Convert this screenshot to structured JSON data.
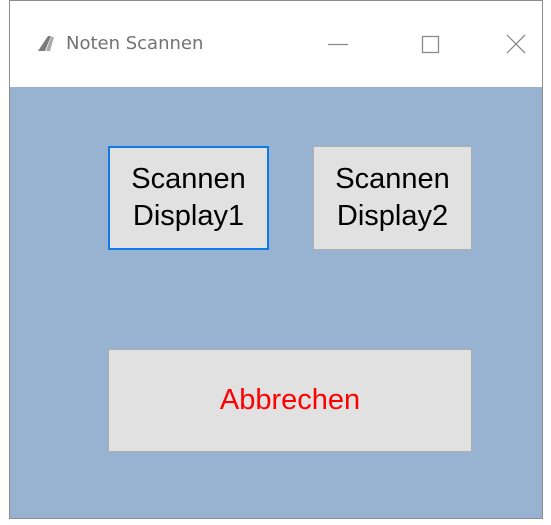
{
  "window": {
    "title": "Noten Scannen",
    "app_icon": "app-logo-icon",
    "controls": {
      "minimize_icon": "minimize-icon",
      "maximize_icon": "maximize-icon",
      "close_icon": "close-icon"
    }
  },
  "buttons": {
    "scan_display1": "Scannen\nDisplay1",
    "scan_display2": "Scannen\nDisplay2",
    "cancel": "Abbrechen"
  },
  "colors": {
    "client_background": "#98b3d2",
    "button_face": "#e1e1e1",
    "focus_border": "#0f7ae5",
    "cancel_text": "#ff0000"
  }
}
